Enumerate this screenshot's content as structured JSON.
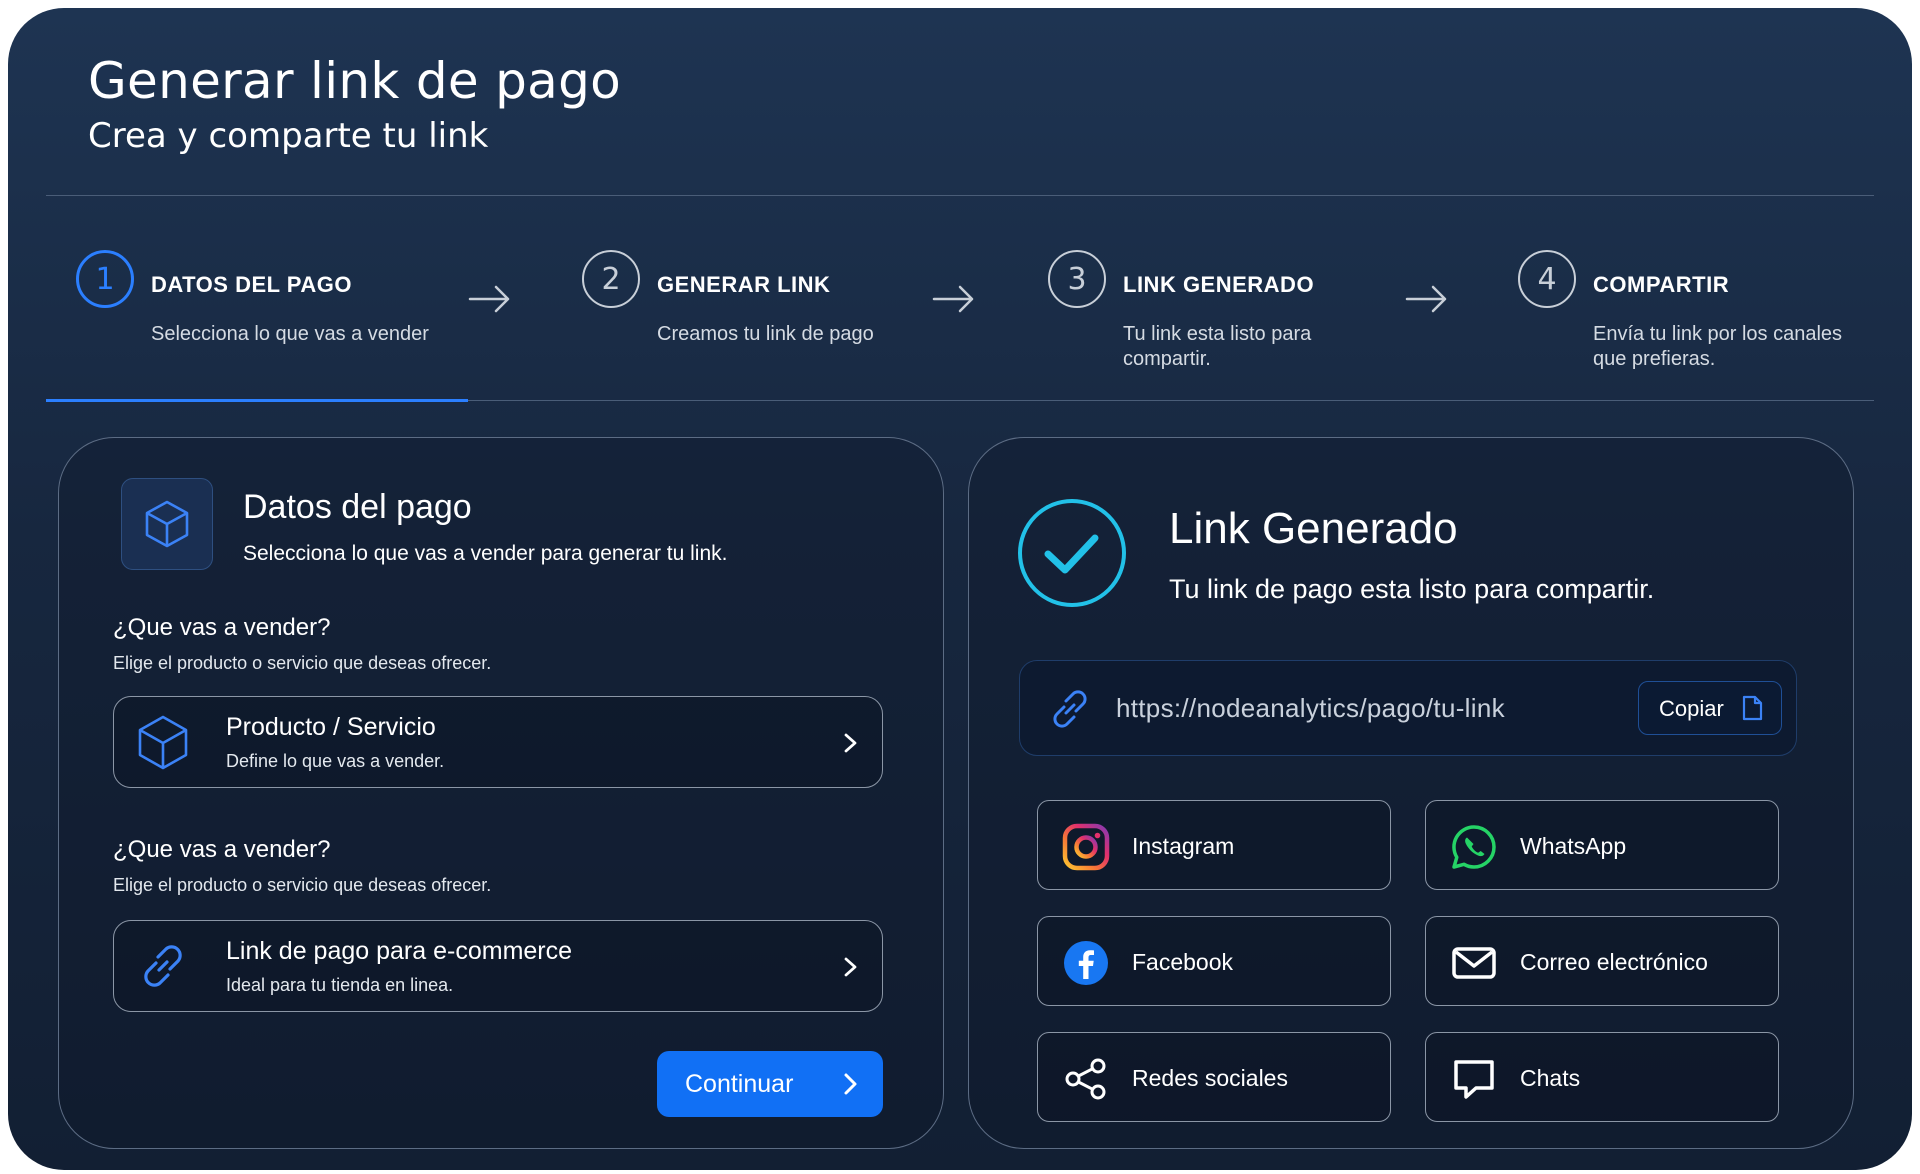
{
  "header": {
    "title": "Generar link de pago",
    "subtitle": "Crea y comparte tu link"
  },
  "steps": [
    {
      "number": "1",
      "label": "DATOS DEL PAGO",
      "description": "Selecciona lo que vas a vender",
      "active": true
    },
    {
      "number": "2",
      "label": "GENERAR LINK",
      "description": "Creamos tu link de pago",
      "active": false
    },
    {
      "number": "3",
      "label": "LINK GENERADO",
      "description": "Tu link esta listo para compartir.",
      "active": false
    },
    {
      "number": "4",
      "label": "COMPARTIR",
      "description": "Envía tu link por los canales que prefieras.",
      "active": false
    }
  ],
  "payment_card": {
    "icon": "cube-icon",
    "title": "Datos del pago",
    "subtitle": "Selecciona lo que vas a vender para generar tu link.",
    "sections": [
      {
        "question": "¿Que vas a vender?",
        "hint": "Elige el producto o servicio que deseas ofrecer.",
        "option": {
          "icon": "cube-icon",
          "title": "Producto / Servicio",
          "subtitle": "Define lo que vas a vender."
        }
      },
      {
        "question": "¿Que vas a vender?",
        "hint": "Elige el producto o servicio que deseas ofrecer.",
        "option": {
          "icon": "link-icon",
          "title": "Link de pago para e-commerce",
          "subtitle": "Ideal para tu tienda en linea."
        }
      }
    ],
    "continue_label": "Continuar"
  },
  "link_card": {
    "title": "Link Generado",
    "subtitle": "Tu link de pago esta listo para compartir.",
    "url": "https://nodeanalytics/pago/tu-link",
    "copy_label": "Copiar",
    "share_options": [
      {
        "icon": "instagram-icon",
        "label": "Instagram"
      },
      {
        "icon": "whatsapp-icon",
        "label": "WhatsApp"
      },
      {
        "icon": "facebook-icon",
        "label": "Facebook"
      },
      {
        "icon": "mail-icon",
        "label": "Correo electrónico"
      },
      {
        "icon": "share-icon",
        "label": "Redes sociales"
      },
      {
        "icon": "chat-icon",
        "label": "Chats"
      }
    ]
  },
  "colors": {
    "accent": "#1170f5",
    "step_active": "#2b7fff",
    "check": "#22c1e8",
    "whatsapp": "#25d366",
    "facebook": "#1877f2"
  }
}
